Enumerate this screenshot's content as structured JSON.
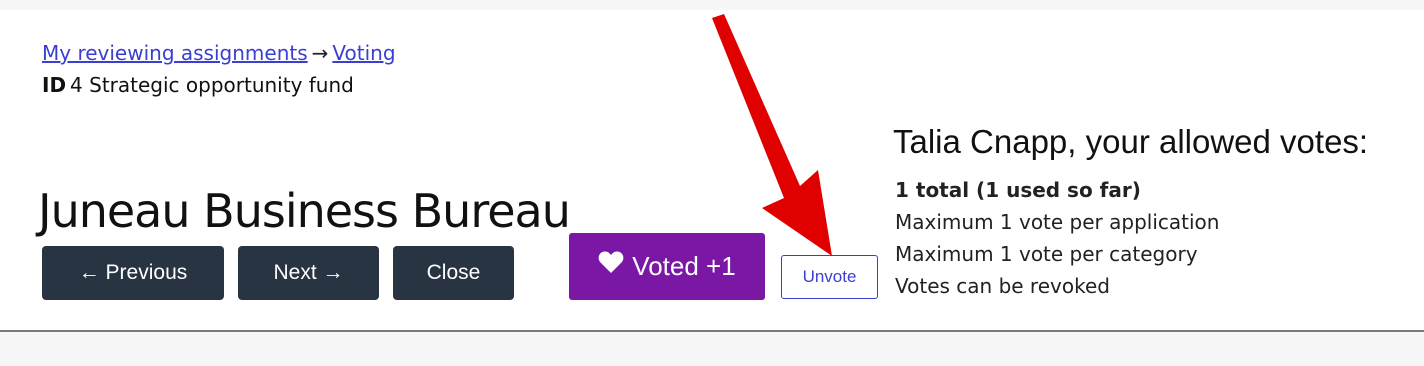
{
  "breadcrumb": {
    "link1": "My reviewing assignments",
    "separator": "→",
    "link2": "Voting"
  },
  "id_line": {
    "label": "ID",
    "value": "4 Strategic opportunity fund"
  },
  "page_title": "Juneau Business Bureau",
  "nav_buttons": {
    "previous": "← Previous",
    "next": "Next →",
    "close": "Close"
  },
  "vote": {
    "voted_label": "Voted +1",
    "unvote_label": "Unvote"
  },
  "allowed_votes": {
    "heading": "Talia Cnapp, your allowed votes:",
    "total": "1 total (1 used so far)",
    "rule1": "Maximum 1 vote per application",
    "rule2": "Maximum 1 vote per category",
    "rule3": "Votes can be revoked"
  },
  "colors": {
    "dark_button": "#283442",
    "voted_button": "#7a17a4",
    "link": "#3b3fd1",
    "arrow": "#e00000"
  },
  "icons": {
    "voted_icon": "heart-icon",
    "annotation": "red-arrow-icon"
  }
}
